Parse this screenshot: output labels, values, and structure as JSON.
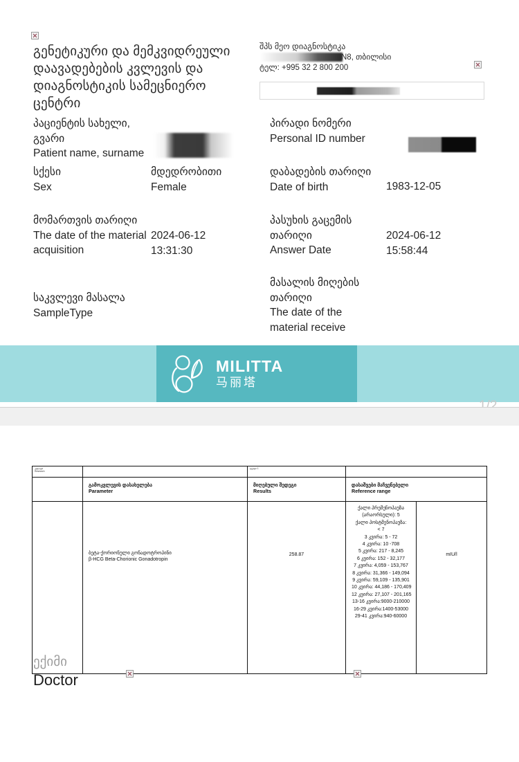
{
  "document": {
    "org_title": "გენეტიკური და მემკვიდრეული დაავადებების კვლევის და დიაგნოსტიკის სამეცნიერო ცენტრი",
    "clinic_name": "შპს მეო დიაგნოსტიკა",
    "clinic_address_tail": "N8, თბილისი",
    "clinic_phone": "ტელ: +995 32 2 800 200",
    "page_number": "1/2"
  },
  "fields": {
    "patient_name": {
      "label_ka": "პაციენტის სახელი, გვარი",
      "label_en": "Patient name, surname",
      "value": ""
    },
    "personal_id": {
      "label_ka": "პირადი ნომერი",
      "label_en": "Personal ID number",
      "value": ""
    },
    "sex": {
      "label_ka": "სქესი",
      "label_en": "Sex",
      "value_ka": "მდედრობითი",
      "value_en": "Female"
    },
    "date_of_birth": {
      "label_ka": "დაბადების თარიღი",
      "label_en": "Date of birth",
      "value": "1983-12-05"
    },
    "acquisition_date": {
      "label_ka": "მომართვის თარიღი",
      "label_en": "The date of the material acquisition",
      "value_date": "2024-06-12",
      "value_time": "13:31:30"
    },
    "answer_date": {
      "label_ka": "პასუხის გაცემის თარიღი",
      "label_en": "Answer Date",
      "value_date": "2024-06-12",
      "value_time": "15:58:44"
    },
    "sample_type": {
      "label_ka": "საკვლევი მასალა",
      "label_en": "SampleType",
      "value": ""
    },
    "material_receive_date": {
      "label_ka": "მასალის მიღების თარიღი",
      "label_en": "The date of the material receive",
      "value": ""
    }
  },
  "watermark": {
    "brand": "MILITTA",
    "brand_cn": "马丽塔"
  },
  "results_table": {
    "micro_label_left_ka": "კვლევა",
    "micro_label_left_en": "Research",
    "micro_label_mid": "ჯგუფი 1",
    "headers": [
      {
        "ka": "გამოკვლევის დასახელება",
        "en": "Parameter"
      },
      {
        "ka": "მიღებული შედეგი",
        "en": "Results"
      },
      {
        "ka": "დასაშვები მაჩვენებელი",
        "en": "Reference range"
      },
      {
        "ka": "",
        "en": ""
      }
    ],
    "rows": [
      {
        "parameter_ka": "ბეტა-ქორიონული გონადოტროპინი",
        "parameter_en": "β-HCG Beta-Chorionic Gonadotropin",
        "result": "258.87",
        "unit": "mIU/l",
        "reference_lines": [
          "ქალი პრემენოპაუზა",
          "(არაორსული): 5",
          "ქალი პოსტმენოპაუზა:",
          "< 7",
          "3 კვირა: 5 - 72",
          "4 კვირა: 10 -708",
          "5 კვირა: 217 - 8,245",
          "6 კვირა: 152 - 32,177",
          "7 კვირა: 4,059 - 153,767",
          "8 კვირა: 31,366 - 149,094",
          "9 კვირა: 59,109 - 135,901",
          "10 კვირა: 44,186 - 170,409",
          "12 კვირა: 27,107 - 201,165",
          "13-16 კვირა:9000-210000",
          "16-29 კვირა:1400-53000",
          "29-41 კვირა:940-60000"
        ]
      }
    ]
  },
  "footer": {
    "doctor_ka": "ექიმი",
    "doctor_en": "Doctor"
  },
  "colors": {
    "watermark_band": "#9FDCE0",
    "watermark_block": "#56B8C0",
    "page_number": "#c9c9c9"
  }
}
